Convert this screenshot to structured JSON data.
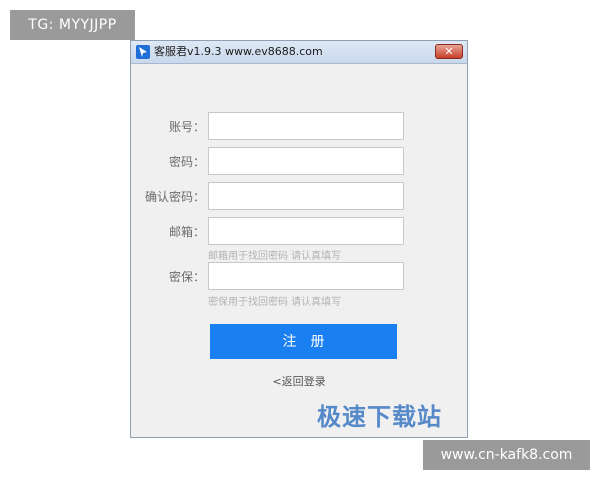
{
  "watermarks": {
    "top_left": "TG: MYYJJPP",
    "bottom_right": "www.cn-kafk8.com",
    "brand": "极速下载站"
  },
  "window": {
    "title": "客服君v1.9.3 www.ev8688.com",
    "close_glyph": "✕",
    "icon": "app-arrow-icon"
  },
  "form": {
    "account": {
      "label": "账号：",
      "value": "",
      "placeholder": ""
    },
    "password": {
      "label": "密码：",
      "value": "",
      "placeholder": ""
    },
    "confirm_password": {
      "label": "确认密码：",
      "value": "",
      "placeholder": ""
    },
    "email": {
      "label": "邮箱：",
      "value": "",
      "placeholder": "",
      "hint": "邮箱用于找回密码 请认真填写"
    },
    "security": {
      "label": "密保：",
      "value": "",
      "placeholder": "",
      "hint": "密保用于找回密码 请认真填写"
    },
    "register_label": "注册",
    "back_label": "<返回登录"
  },
  "colors": {
    "accent": "#1a7ff0",
    "window_bg": "#f0f0f0",
    "close": "#c7402a"
  }
}
